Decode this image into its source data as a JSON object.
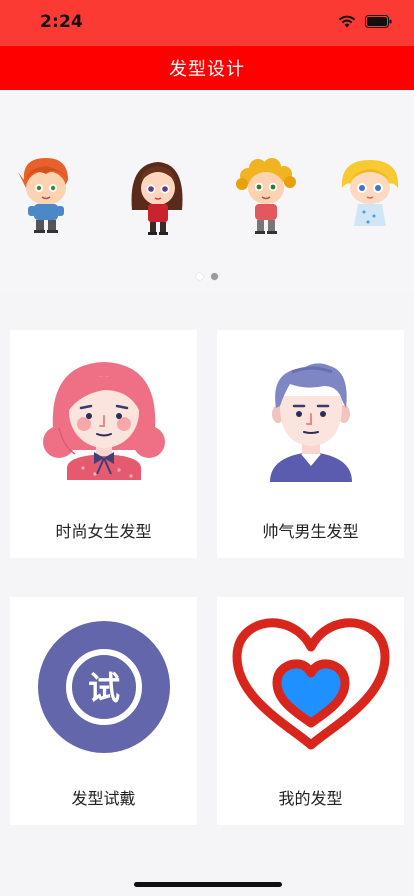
{
  "status_bar": {
    "time": "2:24",
    "icons": [
      "signal-icon",
      "wifi-icon",
      "battery-icon"
    ]
  },
  "nav": {
    "title": "发型设计"
  },
  "banner": {
    "characters": [
      "red-haired-boy",
      "brown-haired-girl",
      "curly-haired-boy",
      "blonde-girl"
    ],
    "page_count": 2,
    "active_page": 2
  },
  "cards": [
    {
      "label": "时尚女生发型",
      "icon": "girl-avatar-icon"
    },
    {
      "label": "帅气男生发型",
      "icon": "boy-avatar-icon"
    },
    {
      "label": "发型试戴",
      "icon": "try-on-icon",
      "glyph": "试",
      "color": "#6366ab"
    },
    {
      "label": "我的发型",
      "icon": "heart-icon",
      "color": "#d9261c"
    }
  ],
  "colors": {
    "nav": "#ff0000",
    "status": "#fb3a34",
    "accent_blue": "#1e90ff"
  }
}
